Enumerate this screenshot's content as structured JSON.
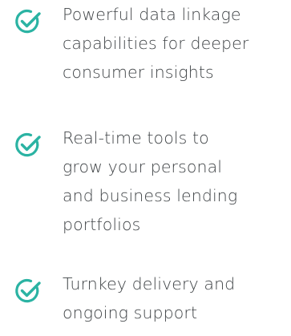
{
  "features": [
    {
      "icon": "check-circle-icon",
      "lines": [
        "Powerful data linkage",
        "capabilities for deeper",
        "consumer insights"
      ]
    },
    {
      "icon": "check-circle-icon",
      "lines": [
        "Real-time tools to",
        "grow your personal",
        "and business lending",
        "portfolios"
      ]
    },
    {
      "icon": "check-circle-icon",
      "lines": [
        "Turnkey delivery and",
        "ongoing support"
      ]
    }
  ],
  "colors": {
    "icon": "#2bb3a3",
    "text": "#3f4346",
    "background": "#ffffff"
  }
}
